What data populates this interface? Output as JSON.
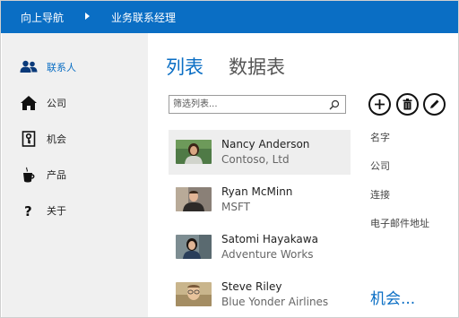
{
  "topbar": {
    "nav_up_label": "向上导航",
    "app_title": "业务联系经理"
  },
  "sidebar": {
    "items": [
      {
        "label": "联系人",
        "icon": "people-icon",
        "active": true
      },
      {
        "label": "公司",
        "icon": "house-icon",
        "active": false
      },
      {
        "label": "机会",
        "icon": "key-icon",
        "active": false
      },
      {
        "label": "产品",
        "icon": "coffee-cup-icon",
        "active": false
      },
      {
        "label": "关于",
        "icon": "question-icon",
        "active": false
      }
    ]
  },
  "main": {
    "tabs": [
      {
        "label": "列表",
        "selected": true
      },
      {
        "label": "数据表",
        "selected": false
      }
    ],
    "search": {
      "placeholder": "筛选列表..."
    },
    "contacts": [
      {
        "name": "Nancy Anderson",
        "company": "Contoso, Ltd",
        "selected": true
      },
      {
        "name": "Ryan McMinn",
        "company": "MSFT",
        "selected": false
      },
      {
        "name": "Satomi Hayakawa",
        "company": "Adventure Works",
        "selected": false
      },
      {
        "name": "Steve Riley",
        "company": "Blue Yonder Airlines",
        "selected": false
      }
    ],
    "actions": [
      {
        "icon": "add-icon"
      },
      {
        "icon": "delete-icon"
      },
      {
        "icon": "edit-icon"
      }
    ],
    "fields": [
      "名字",
      "公司",
      "连接",
      "电子邮件地址"
    ],
    "more_link": "机会..."
  },
  "colors": {
    "accent": "#0a6ec4",
    "sidebar_bg": "#f0f0f0",
    "selected_row_bg": "#eeeeee"
  }
}
